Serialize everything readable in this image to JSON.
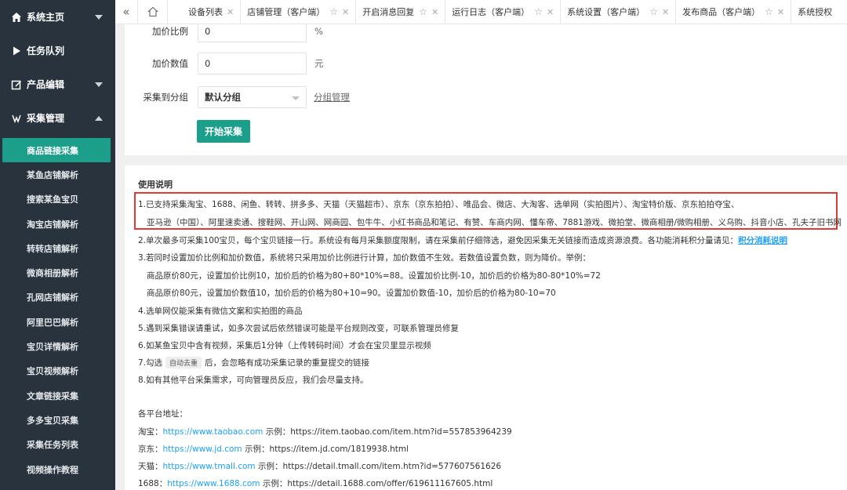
{
  "sidebar": {
    "top_items": [
      {
        "label": "系统主页",
        "icon": "home-icon"
      },
      {
        "label": "任务队列",
        "icon": "play-icon"
      },
      {
        "label": "产品编辑",
        "icon": "edit-icon"
      },
      {
        "label": "采集管理",
        "icon": "collect-icon"
      }
    ],
    "sub_items": [
      "商品链接采集",
      "某鱼店铺解析",
      "搜索某鱼宝贝",
      "淘宝店铺解析",
      "转转店铺解析",
      "微商相册解析",
      "孔网店铺解析",
      "阿里巴巴解析",
      "宝贝详情解析",
      "宝贝视频解析",
      "文章链接采集",
      "多多宝贝采集",
      "采集任务列表",
      "视频操作教程"
    ]
  },
  "tabs": [
    {
      "label": "设备列表"
    },
    {
      "label": "店铺管理（客户端）"
    },
    {
      "label": "开启消息回复"
    },
    {
      "label": "运行日志（客户端）"
    },
    {
      "label": "系统设置（客户端）"
    },
    {
      "label": "发布商品（客户端）"
    },
    {
      "label": "系统授权"
    }
  ],
  "form": {
    "ratio_label": "加价比例",
    "ratio_value": "0",
    "ratio_unit": "%",
    "amount_label": "加价数值",
    "amount_value": "0",
    "amount_unit": "元",
    "group_label": "采集到分组",
    "group_value": "默认分组",
    "group_link": "分组管理",
    "start_button": "开始采集"
  },
  "help": {
    "title": "使用说明",
    "line1a": "1.已支持采集淘宝、1688、闲鱼、转转、拼多多、天猫（天猫超市）、京东（京东拍拍）、唯品会、微店、大淘客、选单网（实拍图片）、淘宝特价版、京东拍拍夺宝、",
    "line1b": "亚马逊（中国）、阿里速卖通、搜鞋网、开山网、网商园、包牛牛、小红书商品和笔记、有赞、车商内网、懂车帝、7881游戏、微拍堂、微商相册/微购相册、义乌购、抖音小店、孔夫子旧书网（拍卖）",
    "line2": "2.单次最多可采集100宝贝，每个宝贝链接一行。系统设有每月采集额度限制，请在采集前仔细筛选，避免因采集无关链接而造成资源浪费。各功能消耗积分量请见：",
    "line2_link": "积分消耗说明",
    "line3": "3.若同时设置加价比例和加价数值，系统将只采用加价比例进行计算，加价数值不生效。若数值设置负数，则为降价。举例：",
    "line3a": "商品原价80元，设置加价比例10，加价后的价格为80+80*10%=88。设置加价比例-10，加价后的价格为80-80*10%=72",
    "line3b": "商品原价80元，设置加价数值10，加价后的价格为80+10=90。设置加价数值-10，加价后的价格为80-10=70",
    "line4": "4.选单网仅能采集有微信文案和实拍图的商品",
    "line5": "5.遇到采集错误请重试，如多次尝试后依然错误可能是平台规则改变，可联系管理员修复",
    "line6": "6.如某鱼宝贝中含有视频，采集后1分钟（上传转码时间）才会在宝贝里显示视频",
    "line7_pre": "7.勾选",
    "line7_chip": "自动去重",
    "line7_post": "后，会忽略有成功采集记录的重复提交的链接",
    "line8": "8.如有其他平台采集需求，可向管理员反应，我们会尽量支持。",
    "addr_title": "各平台地址：",
    "addrs": [
      {
        "name": "淘宝：",
        "url": "https://www.taobao.com",
        "example": " 示例：https://item.taobao.com/item.htm?id=557853964239"
      },
      {
        "name": "京东：",
        "url": "https://www.jd.com",
        "example": " 示例：https://item.jd.com/1819938.html"
      },
      {
        "name": "天猫：",
        "url": "https://www.tmall.com",
        "example": " 示例：https://detail.tmall.com/item.htm?id=577607561626"
      },
      {
        "name": "1688：",
        "url": "https://www.1688.com",
        "example": " 示例：https://detail.1688.com/offer/619611167605.html"
      }
    ]
  },
  "colors": {
    "sidebar_bg": "#28333e",
    "accent": "#1b9f8b",
    "highlight_border": "#e53935",
    "link": "#1e9fff"
  }
}
